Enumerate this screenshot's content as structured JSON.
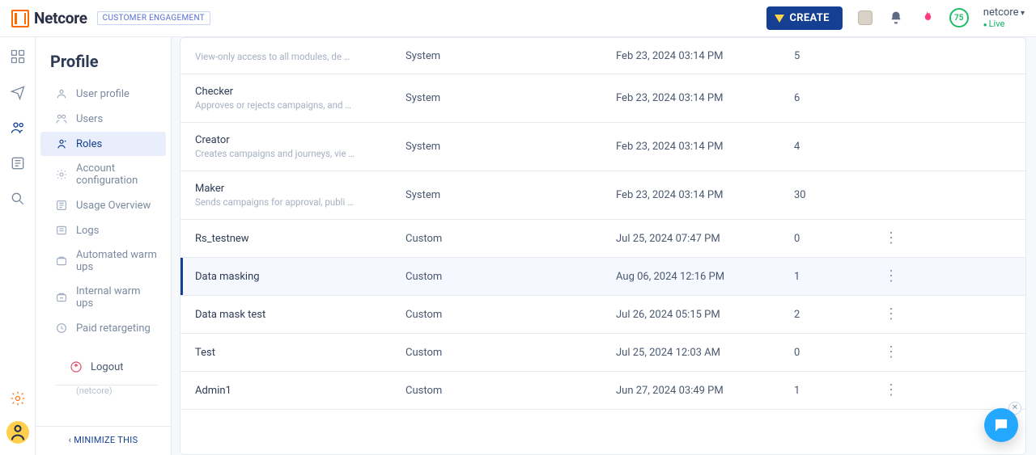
{
  "topbar": {
    "logo_text": "Netcore",
    "product_tag": "CUSTOMER ENGAGEMENT",
    "create_label": "CREATE",
    "score": "75",
    "tenant_name": "netcore",
    "tenant_status": "Live"
  },
  "sidebar": {
    "title": "Profile",
    "items": [
      {
        "label": "User profile"
      },
      {
        "label": "Users"
      },
      {
        "label": "Roles"
      },
      {
        "label": "Account configuration"
      },
      {
        "label": "Usage Overview"
      },
      {
        "label": "Logs"
      },
      {
        "label": "Automated warm ups"
      },
      {
        "label": "Internal warm ups"
      },
      {
        "label": "Paid retargeting"
      }
    ],
    "logout_label": "Logout",
    "logout_sub": "(netcore)",
    "minimize": "MINIMIZE THIS"
  },
  "table": {
    "rows": [
      {
        "name": "",
        "desc": "View-only access to all modules, de …",
        "type": "System",
        "date": "Feb 23, 2024 03:14 PM",
        "count": "5",
        "custom": false,
        "highlight": false
      },
      {
        "name": "Checker",
        "desc": "Approves or rejects campaigns, and …",
        "type": "System",
        "date": "Feb 23, 2024 03:14 PM",
        "count": "6",
        "custom": false,
        "highlight": false
      },
      {
        "name": "Creator",
        "desc": "Creates campaigns and journeys, vie …",
        "type": "System",
        "date": "Feb 23, 2024 03:14 PM",
        "count": "4",
        "custom": false,
        "highlight": false
      },
      {
        "name": "Maker",
        "desc": "Sends campaigns for approval, publi …",
        "type": "System",
        "date": "Feb 23, 2024 03:14 PM",
        "count": "30",
        "custom": false,
        "highlight": false
      },
      {
        "name": "Rs_testnew",
        "desc": "",
        "type": "Custom",
        "date": "Jul 25, 2024 07:47 PM",
        "count": "0",
        "custom": true,
        "highlight": false
      },
      {
        "name": "Data masking",
        "desc": "",
        "type": "Custom",
        "date": "Aug 06, 2024 12:16 PM",
        "count": "1",
        "custom": true,
        "highlight": true
      },
      {
        "name": "Data mask test",
        "desc": "",
        "type": "Custom",
        "date": "Jul 26, 2024 05:15 PM",
        "count": "2",
        "custom": true,
        "highlight": false
      },
      {
        "name": "Test",
        "desc": "",
        "type": "Custom",
        "date": "Jul 25, 2024 12:03 AM",
        "count": "0",
        "custom": true,
        "highlight": false
      },
      {
        "name": "Admin1",
        "desc": "",
        "type": "Custom",
        "date": "Jun 27, 2024 03:49 PM",
        "count": "1",
        "custom": true,
        "highlight": false
      }
    ]
  }
}
